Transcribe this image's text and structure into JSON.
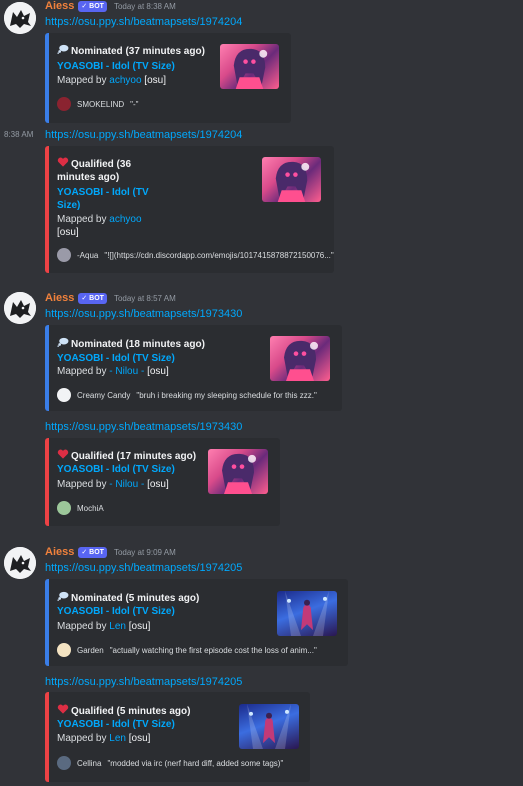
{
  "bot": {
    "name": "Aiess",
    "badge": "✓ BOT"
  },
  "messages": [
    {
      "time": "Today at 8:38 AM",
      "link": "https://osu.ppy.sh/beatmapsets/1974204",
      "embed": {
        "status": "Nominated (37 minutes ago)",
        "song": "YOASOBI - Idol (TV Size)",
        "mapped_by": "Mapped by",
        "mapper": "achyoo",
        "osu": "[osu]",
        "footer_user": "SMOKELIND",
        "footer_text": "\"-\""
      }
    },
    {
      "stamp": "8:38 AM",
      "link": "https://osu.ppy.sh/beatmapsets/1974204",
      "embed": {
        "status_l1": "Qualified (36",
        "status_l2": "minutes ago)",
        "song_l1": "YOASOBI - Idol (TV",
        "song_l2": "Size)",
        "mapped_by": "Mapped by",
        "mapper": "achyoo",
        "osu": "[osu]",
        "footer_user": "-Aqua",
        "footer_text": "\"![](https://cdn.discordapp.com/emojis/1017415878872150076...\""
      }
    },
    {
      "time": "Today at 8:57 AM",
      "link": "https://osu.ppy.sh/beatmapsets/1973430",
      "embed": {
        "status": "Nominated (18 minutes ago)",
        "song": "YOASOBI - Idol (TV Size)",
        "mapped_by": "Mapped by",
        "mapper": "- Nilou -",
        "osu": "[osu]",
        "footer_user": "Creamy Candy",
        "footer_text": "\"bruh i breaking my sleeping schedule for this zzz.\""
      }
    },
    {
      "link": "https://osu.ppy.sh/beatmapsets/1973430",
      "embed": {
        "status": "Qualified (17 minutes ago)",
        "song": "YOASOBI - Idol (TV Size)",
        "mapped_by": "Mapped by",
        "mapper": "- Nilou -",
        "osu": "[osu]",
        "footer_user": "MochiA",
        "footer_text": ""
      }
    },
    {
      "time": "Today at 9:09 AM",
      "link": "https://osu.ppy.sh/beatmapsets/1974205",
      "embed": {
        "status": "Nominated (5 minutes ago)",
        "song": "YOASOBI - Idol (TV Size)",
        "mapped_by": "Mapped by",
        "mapper": "Len",
        "osu": "[osu]",
        "footer_user": "Garden",
        "footer_text": "\"actually watching the first episode cost the loss of anim...\""
      }
    },
    {
      "link": "https://osu.ppy.sh/beatmapsets/1974205",
      "embed": {
        "status": "Qualified (5 minutes ago)",
        "song": "YOASOBI - Idol (TV Size)",
        "mapped_by": "Mapped by",
        "mapper": "Len",
        "osu": "[osu]",
        "footer_user": "Cellina",
        "footer_text": "\"modded via irc (nerf hard diff, added some tags)\""
      }
    }
  ],
  "icons": {
    "nominated": "thought-bubble-icon",
    "qualified": "red-heart-icon",
    "avatar": "wolf-logo-icon"
  },
  "colors": {
    "nominated_bar": "#3a7ee8",
    "qualified_bar": "#ed4245",
    "link": "#00a8fc",
    "username": "#f0813c",
    "bot_badge": "#5865f2"
  }
}
